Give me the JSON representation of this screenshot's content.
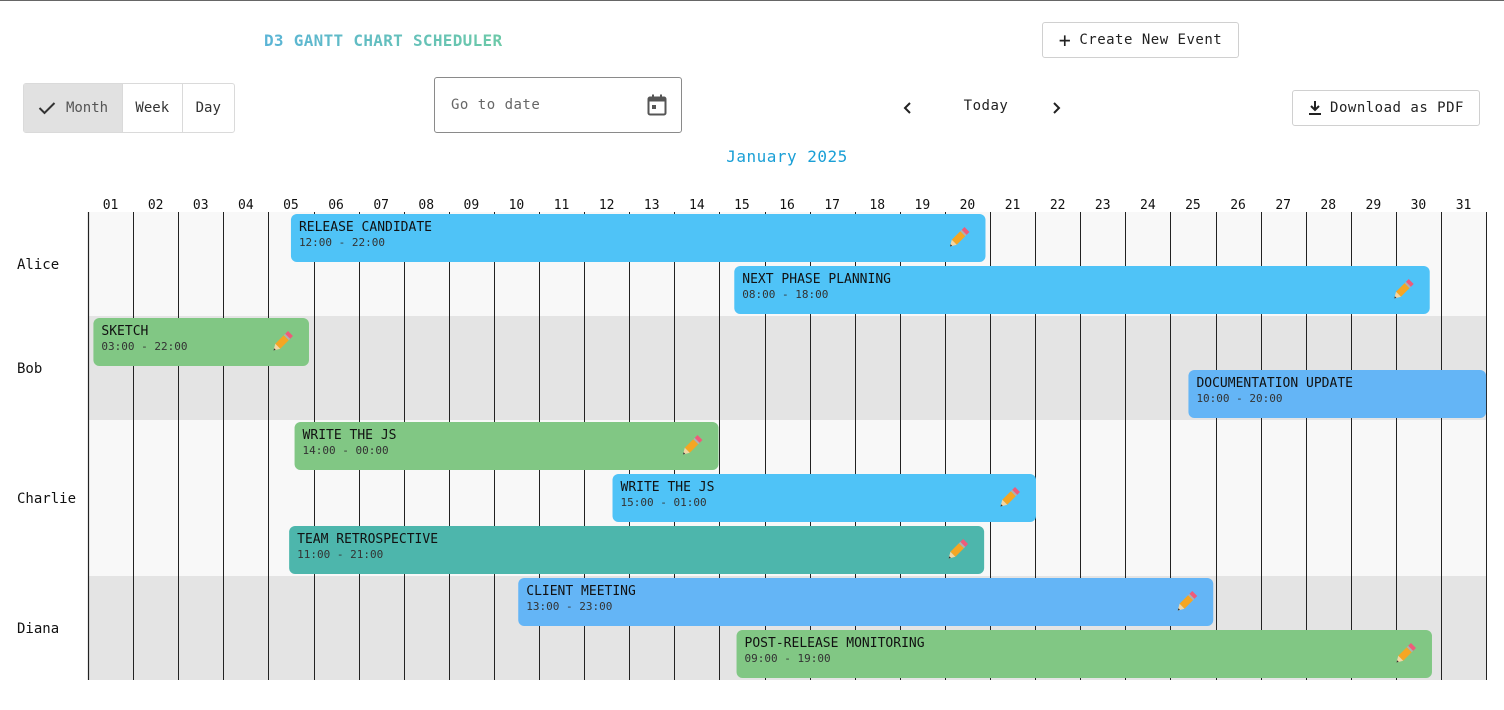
{
  "header": {
    "title": "D3 GANTT CHART SCHEDULER",
    "create_label": "Create New Event"
  },
  "toolbar": {
    "views": [
      "Month",
      "Week",
      "Day"
    ],
    "active_view": "Month",
    "date_placeholder": "Go to date",
    "today_label": "Today",
    "download_label": "Download as PDF"
  },
  "calendar": {
    "month_label": "January 2025",
    "days": [
      "01",
      "02",
      "03",
      "04",
      "05",
      "06",
      "07",
      "08",
      "09",
      "10",
      "11",
      "12",
      "13",
      "14",
      "15",
      "16",
      "17",
      "18",
      "19",
      "20",
      "21",
      "22",
      "23",
      "24",
      "25",
      "26",
      "27",
      "28",
      "29",
      "30",
      "31"
    ]
  },
  "colors": {
    "blue": "#4fc3f7",
    "blue2": "#64b5f6",
    "green": "#81c784",
    "teal": "#4db6ac",
    "row_light": "#f8f8f8",
    "row_dark": "#e4e4e4"
  },
  "rows": [
    {
      "name": "Alice",
      "lanes": 2
    },
    {
      "name": "Bob",
      "lanes": 2
    },
    {
      "name": "Charlie",
      "lanes": 3
    },
    {
      "name": "Diana",
      "lanes": 2
    }
  ],
  "events": [
    {
      "row": 0,
      "lane": 0,
      "title": "RELEASE CANDIDATE",
      "time": "12:00 - 22:00",
      "start": 5.5,
      "end": 20.9,
      "color": "blue"
    },
    {
      "row": 0,
      "lane": 1,
      "title": "NEXT PHASE PLANNING",
      "time": "08:00 - 18:00",
      "start": 15.33,
      "end": 30.75,
      "color": "blue"
    },
    {
      "row": 1,
      "lane": 0,
      "title": "SKETCH",
      "time": "03:00 - 22:00",
      "start": 1.12,
      "end": 5.9,
      "color": "green"
    },
    {
      "row": 1,
      "lane": 1,
      "title": "DOCUMENTATION UPDATE",
      "time": "10:00 - 20:00",
      "start": 25.4,
      "end": 32,
      "color": "blue2"
    },
    {
      "row": 2,
      "lane": 0,
      "title": "WRITE THE JS",
      "time": "14:00 - 00:00",
      "start": 5.58,
      "end": 14.98,
      "color": "green"
    },
    {
      "row": 2,
      "lane": 1,
      "title": "WRITE THE JS",
      "time": "15:00 - 01:00",
      "start": 12.63,
      "end": 22.02,
      "color": "blue"
    },
    {
      "row": 2,
      "lane": 2,
      "title": "TEAM RETROSPECTIVE",
      "time": "11:00 - 21:00",
      "start": 5.46,
      "end": 20.87,
      "color": "teal"
    },
    {
      "row": 3,
      "lane": 0,
      "title": "CLIENT MEETING",
      "time": "13:00 - 23:00",
      "start": 10.54,
      "end": 25.95,
      "color": "blue2"
    },
    {
      "row": 3,
      "lane": 1,
      "title": "POST-RELEASE MONITORING",
      "time": "09:00 - 19:00",
      "start": 15.38,
      "end": 30.8,
      "color": "green"
    }
  ]
}
